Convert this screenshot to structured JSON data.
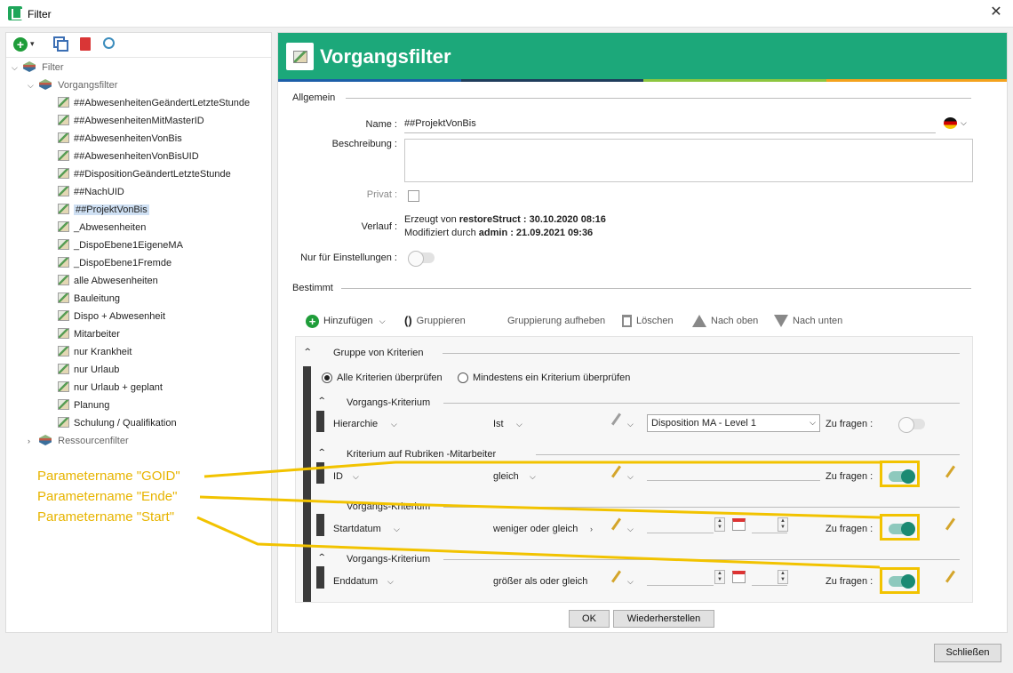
{
  "window": {
    "title": "Filter",
    "close_glyph": "✕"
  },
  "left_toolbar": {
    "icons": [
      "add-icon",
      "copy-icon",
      "delete-icon",
      "find-icon"
    ]
  },
  "tree": {
    "root": "Filter",
    "group1": "Vorgangsfilter",
    "items": [
      "##AbwesenheitenGeändertLetzteStunde",
      "##AbwesenheitenMitMasterID",
      "##AbwesenheitenVonBis",
      "##AbwesenheitenVonBisUID",
      "##DispositionGeändertLetzteStunde",
      "##NachUID",
      "##ProjektVonBis",
      "_Abwesenheiten",
      "_DispoEbene1EigeneMA",
      "_DispoEbene1Fremde",
      "alle Abwesenheiten",
      "Bauleitung",
      "Dispo + Abwesenheit",
      "Mitarbeiter",
      "nur Krankheit",
      "nur Urlaub",
      "nur Urlaub + geplant",
      "Planung",
      "Schulung / Qualifikation"
    ],
    "selected_index": 6,
    "group2": "Ressourcenfilter"
  },
  "header": {
    "title": "Vorgangsfilter",
    "accent_colors": [
      "#1c5ea8",
      "#1f3d5c",
      "#8dc63f",
      "#f4a21d"
    ],
    "banner_color": "#1ca87a"
  },
  "allgemein": {
    "section": "Allgemein",
    "name_label": "Name :",
    "name_value": "##ProjektVonBis",
    "beschreibung_label": "Beschreibung :",
    "privat_label": "Privat :",
    "verlauf_label": "Verlauf :",
    "verlauf_line1_prefix": "Erzeugt von ",
    "verlauf_line1_value": "restoreStruct : 30.10.2020 08:16",
    "verlauf_line2_prefix": "Modifiziert durch ",
    "verlauf_line2_value": "admin : 21.09.2021 09:36",
    "nur_label": "Nur für Einstellungen :"
  },
  "bestimmt": {
    "section": "Bestimmt",
    "actions": {
      "add": "Hinzufügen",
      "group": "Gruppieren",
      "ungroup": "Gruppierung aufheben",
      "delete": "Löschen",
      "up": "Nach oben",
      "down": "Nach unten",
      "group_glyph": "()"
    },
    "group_title": "Gruppe von Kriterien",
    "radio_all": "Alle Kriterien überprüfen",
    "radio_any": "Mindestens ein Kriterium überprüfen",
    "ask_label": "Zu fragen :",
    "criteria": [
      {
        "title": "Vorgangs-Kriterium",
        "field": "Hierarchie",
        "op": "Ist",
        "value": "Disposition MA - Level 1"
      },
      {
        "title": "Kriterium auf Rubriken -Mitarbeiter",
        "field": "ID",
        "op": "gleich",
        "value": ""
      },
      {
        "title": "Vorgangs-Kriterium",
        "field": "Startdatum",
        "op": "weniger oder gleich",
        "value": ""
      },
      {
        "title": "Vorgangs-Kriterium",
        "field": "Enddatum",
        "op": "größer als oder gleich",
        "value": ""
      }
    ]
  },
  "footer": {
    "ok": "OK",
    "restore": "Wiederherstellen",
    "close": "Schließen"
  },
  "annotations": {
    "goid": "Parametername \"GOID\"",
    "ende": "Parametername \"Ende\"",
    "start": "Parametername \"Start\"",
    "color": "#f2c300"
  }
}
